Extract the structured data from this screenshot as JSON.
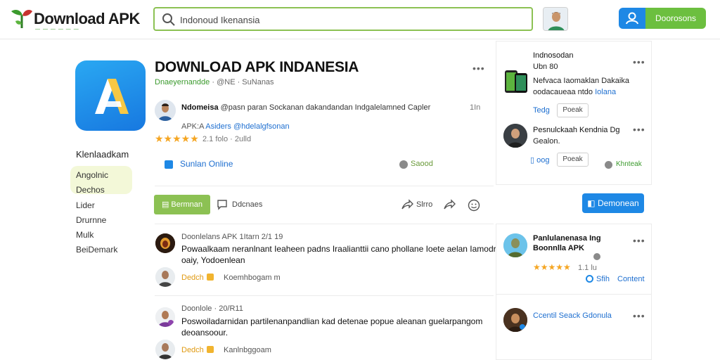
{
  "header": {
    "logo_title": "Download APK",
    "logo_tagline": "— — — — — —",
    "search_value": "Indonoud Ikenansia",
    "login_label": "Doorosons"
  },
  "sidebar": {
    "heading": "Klenlaadkam",
    "items": [
      "Angolnic",
      "Dechos",
      "Lider",
      "Drurnne",
      "Mulk",
      "BeiDemark"
    ]
  },
  "app": {
    "title": "DOWNLOAD APK INDANESIA",
    "developer": "Dnaeyernandde",
    "sub_rest": "· @NE · SuNanas",
    "more": "•••",
    "dev_name": "Ndomeisa",
    "dev_line1": "@pasn paran Sockanan dakandandan Indgalelamned Capler",
    "dev_time": "1In",
    "dev_line2_prefix": "APK:A",
    "dev_line2_tag": "Asiders @hdelalgfsonan",
    "rating_stars": "★★★★★",
    "rating_text": "2.1 folo · 2ulld",
    "online_label": "Sunlan Online",
    "saved_label": "Saood"
  },
  "actions": {
    "download": "Bermnan",
    "comments": "Ddcnaes",
    "share": "Slrro",
    "primary": "Demonean"
  },
  "comments": [
    {
      "meta": "Doonlelans APK 1Itarn 2/1 19",
      "body": "Powaalkaam neranlnant Ieaheen padns Iraalianttii cano phollane Ioete aelan Iamodra oaiy, Yodoenlean",
      "badge": "Dedch",
      "sub": "Koemhbogam m"
    },
    {
      "meta": "Doonlole · 20/R11",
      "body": "Poswoiladarnidan partilenanpandlian kad detenae popue aleanan guelarpangom deoansoour.",
      "badge": "Dedch",
      "sub": "Kanlnbggoam"
    }
  ],
  "right": {
    "card1": {
      "title": "Indnosodan",
      "sub": "Ubn 80",
      "text": "Nefvaca Iaomaklan Dakaika",
      "text2": "oodacaueaa ntdo",
      "link": "Iolana",
      "link2": "Tedg",
      "btn": "Poeak",
      "more": "•••"
    },
    "card2": {
      "text": "Pesnulckaah Kendnia Dg",
      "text2": "Gealon.",
      "link": "oog",
      "btn": "Poeak",
      "green": "Khnteak",
      "more": "•••"
    },
    "card3": {
      "title": "Panlulanenasa Ing",
      "title2": "Boonnlla APK",
      "stars": "★★★★★",
      "rating": "1.1 lu",
      "link": "Sfih",
      "link2": "Content",
      "more": "•••"
    },
    "card4": {
      "title": "Ccentil Seack Gdonula",
      "more": "•••"
    }
  }
}
